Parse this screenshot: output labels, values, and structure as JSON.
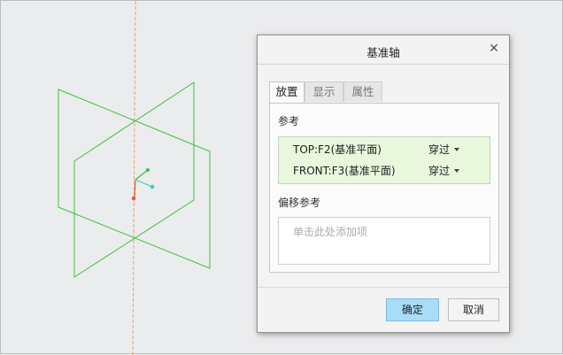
{
  "dialog": {
    "title": "基准轴",
    "close_icon": "close-icon",
    "tabs": [
      {
        "label": "放置",
        "active": true
      },
      {
        "label": "显示",
        "active": false
      },
      {
        "label": "属性",
        "active": false
      }
    ],
    "references_label": "参考",
    "references": [
      {
        "name": "TOP:F2(基准平面)",
        "type": "穿过"
      },
      {
        "name": "FRONT:F3(基准平面)",
        "type": "穿过"
      }
    ],
    "offset_label": "偏移参考",
    "offset_placeholder": "单击此处添加项",
    "ok_label": "确定",
    "cancel_label": "取消"
  },
  "colors": {
    "viewport_bg": "#ebeced",
    "datum_plane": "#3bc23b",
    "axis_line": "#f0a070",
    "selection_bg": "#e9f7dd",
    "ok_button": "#a8dcf8"
  }
}
